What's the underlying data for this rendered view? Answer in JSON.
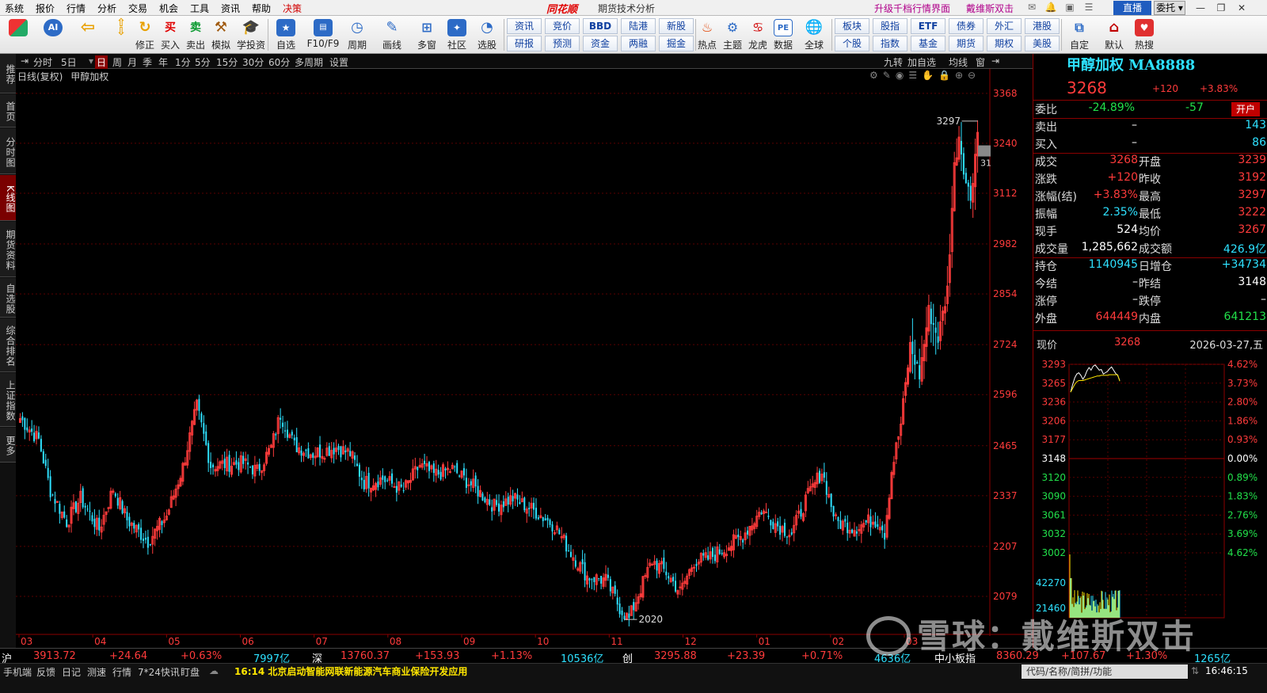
{
  "menubar": {
    "items": [
      "系统",
      "报价",
      "行情",
      "分析",
      "交易",
      "机会",
      "工具",
      "资讯",
      "帮助",
      "决策"
    ],
    "logo": "同花顺",
    "subtitle": "期货技术分析",
    "promo1": "升级千档行情界面",
    "promo2": "戴维斯双击",
    "live": "直播",
    "entrust": "委托"
  },
  "toolbar": {
    "buttons": [
      {
        "label": "",
        "icon": "grid-logo-icon"
      },
      {
        "label": "",
        "icon": "ai-icon"
      },
      {
        "label": "",
        "icon": "back-arrow-icon"
      },
      {
        "label": "修正",
        "icon": "refresh-icon"
      },
      {
        "label": "买入",
        "icon": "buy-icon",
        "glyph": "买"
      },
      {
        "label": "卖出",
        "icon": "sell-icon",
        "glyph": "卖"
      },
      {
        "label": "模拟",
        "icon": "hammer-icon"
      },
      {
        "label": "学投资",
        "icon": "graduation-cap-icon"
      },
      {
        "label": "自选",
        "icon": "star-box-icon"
      },
      {
        "label": "F10/F9",
        "icon": "f10-icon"
      },
      {
        "label": "周期",
        "icon": "cycle-clock-icon"
      },
      {
        "label": "画线",
        "icon": "pencil-icon"
      },
      {
        "label": "多窗",
        "icon": "multi-window-icon"
      },
      {
        "label": "社区",
        "icon": "community-icon"
      },
      {
        "label": "选股",
        "icon": "stock-picker-icon"
      }
    ],
    "smallbuttons_top": [
      "资讯",
      "竞价",
      "BBD",
      "陆港",
      "新股"
    ],
    "smallbuttons_bottom": [
      "研报",
      "预测",
      "资金",
      "两融",
      "掘金"
    ],
    "buttons2": [
      {
        "label": "热点",
        "icon": "hot-icon"
      },
      {
        "label": "主题",
        "icon": "theme-icon"
      },
      {
        "label": "龙虎",
        "icon": "dragon-tiger-icon"
      },
      {
        "label": "数据",
        "icon": "pe-data-icon",
        "glyph": "PE"
      },
      {
        "label": "全球",
        "icon": "globe-icon"
      }
    ],
    "smallbuttons2_top": [
      "板块",
      "股指",
      "ETF",
      "债券",
      "外汇",
      "港股"
    ],
    "smallbuttons2_bottom": [
      "个股",
      "指数",
      "基金",
      "期货",
      "期权",
      "美股"
    ],
    "buttons3": [
      {
        "label": "自定",
        "icon": "customize-icon"
      },
      {
        "label": "默认",
        "icon": "home-icon"
      },
      {
        "label": "热搜",
        "icon": "hot-search-icon"
      }
    ]
  },
  "lefttabs": [
    "推荐",
    "首页",
    "分时图",
    "K线图",
    "期货资料",
    "自选股",
    "综合排名",
    "上证指数",
    "更多"
  ],
  "lefttab_active": 3,
  "periodbar": {
    "items": [
      "分时",
      "5日",
      "日",
      "周",
      "月",
      "季",
      "年",
      "1分",
      "5分",
      "15分",
      "30分",
      "60分",
      "多周期",
      "设置"
    ],
    "active": 2,
    "right": [
      "九转",
      "加自选",
      "均线",
      "窗"
    ]
  },
  "chart_header": {
    "type": "日线(复权)",
    "name": "甲醇加权"
  },
  "chart_data": {
    "type": "candlestick",
    "x_labels": [
      "03",
      "04",
      "05",
      "06",
      "07",
      "08",
      "09",
      "10",
      "11",
      "12",
      "01",
      "02",
      "03"
    ],
    "y_ticks": [
      3368,
      3240,
      3112,
      2982,
      2854,
      2724,
      2596,
      2465,
      2337,
      2207,
      2079
    ],
    "ylim": [
      2010,
      3390
    ],
    "annotations": [
      {
        "text": "3297",
        "value": 3297
      },
      {
        "text": "2020",
        "value": 2020
      },
      {
        "text": "31",
        "value": 3190
      }
    ],
    "grid": true,
    "up_color": "#ff3b3b",
    "down_color": "#2ee1ff",
    "anchors": [
      [
        0,
        2535
      ],
      [
        8,
        2480
      ],
      [
        13,
        2350
      ],
      [
        20,
        2270
      ],
      [
        26,
        2330
      ],
      [
        34,
        2250
      ],
      [
        40,
        2355
      ],
      [
        46,
        2275
      ],
      [
        55,
        2220
      ],
      [
        63,
        2285
      ],
      [
        70,
        2410
      ],
      [
        76,
        2565
      ],
      [
        82,
        2415
      ],
      [
        96,
        2420
      ],
      [
        102,
        2400
      ],
      [
        108,
        2460
      ],
      [
        112,
        2545
      ],
      [
        118,
        2465
      ],
      [
        126,
        2445
      ],
      [
        136,
        2460
      ],
      [
        142,
        2445
      ],
      [
        148,
        2370
      ],
      [
        156,
        2380
      ],
      [
        165,
        2350
      ],
      [
        172,
        2415
      ],
      [
        178,
        2390
      ],
      [
        186,
        2405
      ],
      [
        195,
        2360
      ],
      [
        204,
        2310
      ],
      [
        212,
        2330
      ],
      [
        222,
        2295
      ],
      [
        230,
        2260
      ],
      [
        236,
        2200
      ],
      [
        244,
        2130
      ],
      [
        252,
        2120
      ],
      [
        258,
        2050
      ],
      [
        262,
        2020
      ],
      [
        266,
        2085
      ],
      [
        272,
        2170
      ],
      [
        278,
        2140
      ],
      [
        284,
        2090
      ],
      [
        290,
        2170
      ],
      [
        296,
        2175
      ],
      [
        304,
        2205
      ],
      [
        311,
        2235
      ],
      [
        319,
        2300
      ],
      [
        326,
        2260
      ],
      [
        332,
        2240
      ],
      [
        338,
        2325
      ],
      [
        345,
        2400
      ],
      [
        351,
        2270
      ],
      [
        359,
        2255
      ],
      [
        367,
        2275
      ],
      [
        370,
        2270
      ],
      [
        372,
        2240
      ],
      [
        375,
        2400
      ],
      [
        379,
        2520
      ],
      [
        383,
        2720
      ],
      [
        387,
        2645
      ],
      [
        391,
        2810
      ],
      [
        395,
        2740
      ],
      [
        399,
        2865
      ],
      [
        402,
        3180
      ],
      [
        404,
        3260
      ],
      [
        407,
        3140
      ],
      [
        409,
        3100
      ],
      [
        412,
        3268
      ]
    ]
  },
  "quote": {
    "title": "甲醇加权  MA8888",
    "price": "3268",
    "change": "+120",
    "change_pct": "+3.83%",
    "weibi": {
      "label": "委比",
      "pct": "-24.89%",
      "diff": "-57",
      "btn": "开户"
    },
    "sell": {
      "label": "卖出",
      "price": "–",
      "qty": "143"
    },
    "buy": {
      "label": "买入",
      "price": "–",
      "qty": "86"
    },
    "rows": [
      {
        "k1": "成交",
        "v1": "3268",
        "c1": "red",
        "k2": "开盘",
        "v2": "3239",
        "c2": "red"
      },
      {
        "k1": "涨跌",
        "v1": "+120",
        "c1": "red",
        "k2": "昨收",
        "v2": "3192",
        "c2": "red"
      },
      {
        "k1": "涨幅(结)",
        "v1": "+3.83%",
        "c1": "red",
        "k2": "最高",
        "v2": "3297",
        "c2": "red"
      },
      {
        "k1": "振幅",
        "v1": "2.35%",
        "c1": "cyn",
        "k2": "最低",
        "v2": "3222",
        "c2": "red"
      },
      {
        "k1": "现手",
        "v1": "524",
        "c1": "wht",
        "k2": "均价",
        "v2": "3267",
        "c2": "red"
      },
      {
        "k1": "成交量",
        "v1": "1,285,662",
        "c1": "wht",
        "k2": "成交额",
        "v2": "426.9亿",
        "c2": "cyn"
      },
      {
        "k1": "持仓",
        "v1": "1140945",
        "c1": "cyn",
        "k2": "日增仓",
        "v2": "+34734",
        "c2": "cyn"
      },
      {
        "k1": "今结",
        "v1": "–",
        "c1": "wht",
        "k2": "昨结",
        "v2": "3148",
        "c2": "wht"
      },
      {
        "k1": "涨停",
        "v1": "–",
        "c1": "wht",
        "k2": "跌停",
        "v2": "–",
        "c2": "wht"
      },
      {
        "k1": "外盘",
        "v1": "644449",
        "c1": "red",
        "k2": "内盘",
        "v2": "641213",
        "c2": "grn"
      }
    ],
    "mini_header": {
      "label": "现价",
      "price": "3268",
      "date": "2026-03-27,五"
    }
  },
  "mini_chart": {
    "left_ticks": [
      "3293",
      "3265",
      "3236",
      "3206",
      "3177",
      "3148",
      "3120",
      "3090",
      "3061",
      "3032",
      "3002"
    ],
    "right_ticks": [
      "4.62%",
      "3.73%",
      "2.80%",
      "1.86%",
      "0.93%",
      "0.00%",
      "0.89%",
      "1.83%",
      "2.76%",
      "3.69%",
      "4.62%"
    ],
    "vol_ticks": [
      "42270",
      "21460"
    ],
    "price_range": [
      3002,
      3293
    ],
    "prices": [
      3250,
      3262,
      3272,
      3278,
      3280,
      3276,
      3270,
      3275,
      3283,
      3288,
      3284,
      3290,
      3292,
      3288,
      3284,
      3285,
      3278,
      3280,
      3282,
      3286,
      3289,
      3284,
      3279,
      3276,
      3268
    ],
    "avg": [
      3250,
      3256,
      3262,
      3266,
      3268,
      3268,
      3268,
      3269,
      3270,
      3271,
      3272,
      3273,
      3274,
      3275,
      3275,
      3276,
      3276,
      3276,
      3276,
      3277,
      3277,
      3277,
      3277,
      3277,
      3267
    ]
  },
  "statusbar": {
    "sh_label": "沪",
    "sh_val": "3913.72",
    "sh_chg": "+24.64",
    "sh_pct": "+0.63%",
    "sh_amt": "7997亿",
    "sz_label": "深",
    "sz_val": "13760.37",
    "sz_chg": "+153.93",
    "sz_pct": "+1.13%",
    "sz_amt": "10536亿",
    "cy_label": "创",
    "cy_val": "3295.88",
    "cy_chg": "+23.39",
    "cy_pct": "+0.71%",
    "cy_amt": "4636亿",
    "zx_label": "中小板指",
    "zx_val": "8360.29",
    "zx_chg": "+107.67",
    "zx_pct": "+1.30%",
    "zx_amt": "1265亿"
  },
  "bottombar": {
    "items": [
      "手机端",
      "反馈",
      "日记",
      "测速",
      "行情",
      "7*24快讯",
      "盯盘"
    ],
    "news": "16:14 北京启动智能网联新能源汽车商业保险开发应用",
    "search_placeholder": "代码/名称/简拼/功能",
    "clock": "16:46:15"
  },
  "watermark": "雪球：戴维斯双击"
}
